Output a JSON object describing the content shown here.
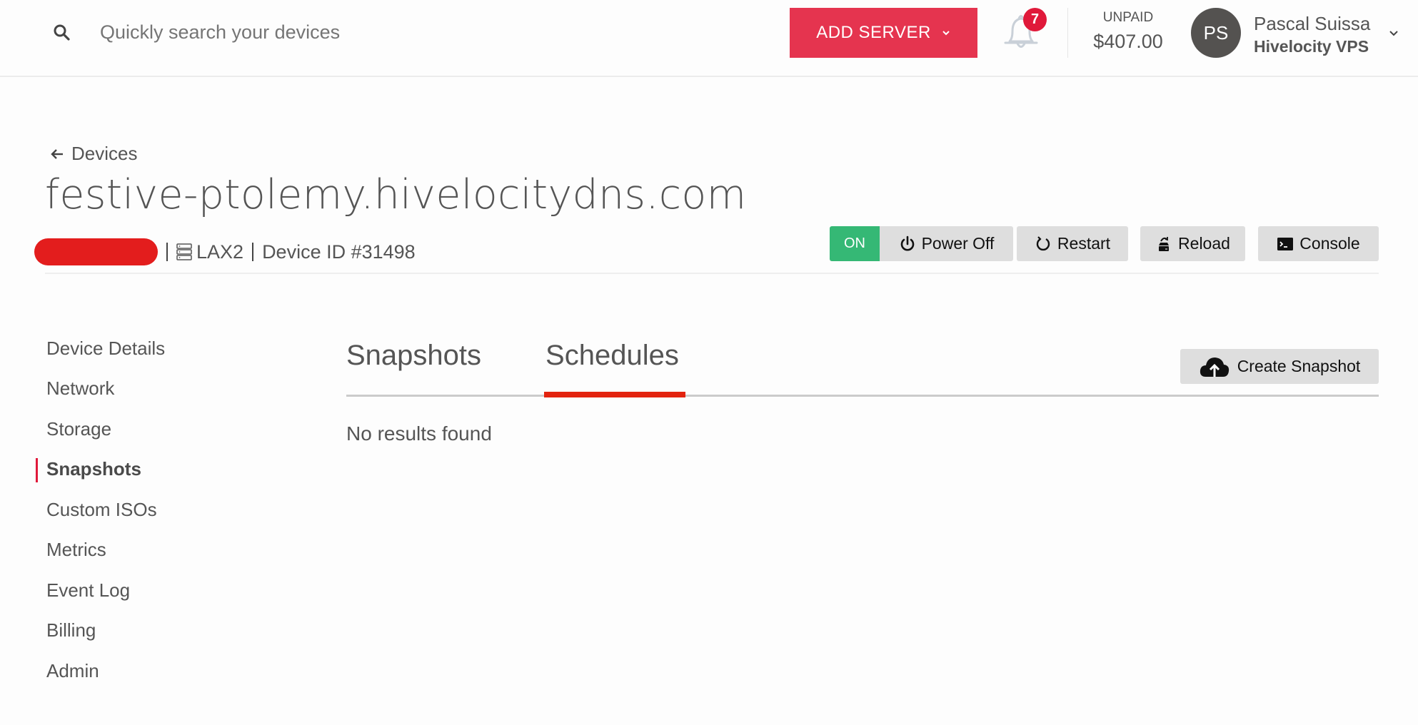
{
  "header": {
    "search": {
      "placeholder": "Quickly search your devices",
      "value": ""
    },
    "add_server_label": "ADD SERVER",
    "notifications": {
      "count": "7"
    },
    "billing": {
      "label": "UNPAID",
      "amount": "$407.00"
    },
    "user": {
      "initials": "PS",
      "name": "Pascal Suissa",
      "company": "Hivelocity VPS"
    }
  },
  "breadcrumb": {
    "back_label": "Devices"
  },
  "device": {
    "hostname": "festive-ptolemy.hivelocitydns.com",
    "location": "LAX2",
    "device_id": "Device ID #31498",
    "power_status": "ON"
  },
  "actions": {
    "power_off": "Power Off",
    "restart": "Restart",
    "reload": "Reload",
    "console": "Console"
  },
  "sidebar": {
    "items": [
      {
        "label": "Device Details",
        "active": false
      },
      {
        "label": "Network",
        "active": false
      },
      {
        "label": "Storage",
        "active": false
      },
      {
        "label": "Snapshots",
        "active": true
      },
      {
        "label": "Custom ISOs",
        "active": false
      },
      {
        "label": "Metrics",
        "active": false
      },
      {
        "label": "Event Log",
        "active": false
      },
      {
        "label": "Billing",
        "active": false
      },
      {
        "label": "Admin",
        "active": false
      }
    ]
  },
  "main": {
    "tabs": [
      {
        "label": "Snapshots",
        "active": false
      },
      {
        "label": "Schedules",
        "active": true
      }
    ],
    "create_button_label": "Create Snapshot",
    "empty_message": "No results found"
  },
  "colors": {
    "brand_red": "#e5344f",
    "status_on": "#35b875",
    "active_tab_underline": "#e3230f",
    "badge_red": "#e0193a"
  }
}
